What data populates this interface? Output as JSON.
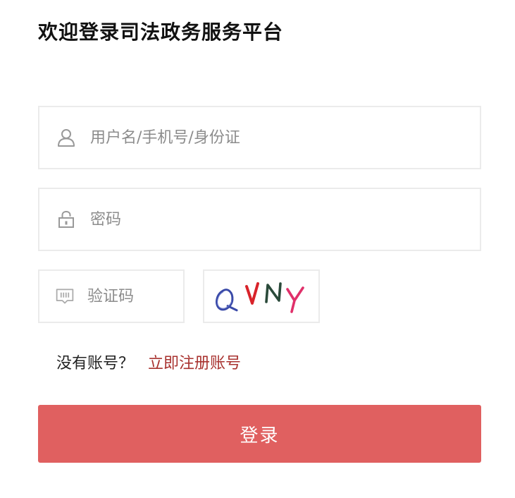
{
  "page": {
    "title": "欢迎登录司法政务服务平台"
  },
  "form": {
    "username": {
      "placeholder": "用户名/手机号/身份证",
      "value": "",
      "icon": "user-icon"
    },
    "password": {
      "placeholder": "密码",
      "value": "",
      "icon": "lock-icon"
    },
    "captcha": {
      "placeholder": "验证码",
      "value": "",
      "icon": "captcha-icon",
      "image_text": "QVNY"
    }
  },
  "register": {
    "prompt": "没有账号？",
    "link_label": "立即注册账号"
  },
  "login_button": {
    "label": "登录"
  },
  "colors": {
    "accent": "#e06060",
    "link": "#a8322f",
    "border": "#ebebeb",
    "placeholder": "#8c8c8c",
    "icon": "#999999"
  }
}
